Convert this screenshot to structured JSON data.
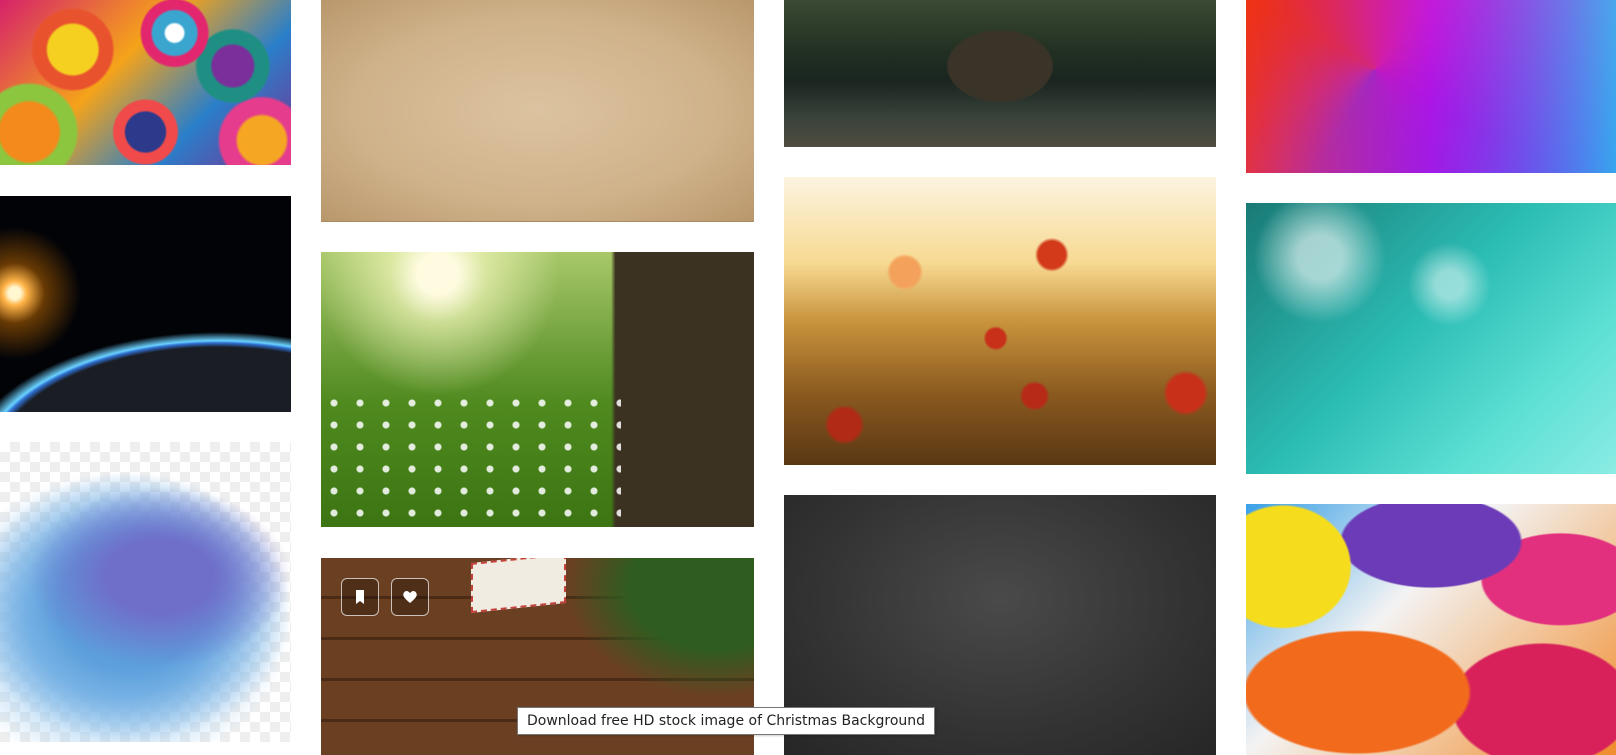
{
  "gallery": {
    "tiles": [
      {
        "icon": "colorful-mandala-image"
      },
      {
        "icon": "earth-from-space-image"
      },
      {
        "icon": "blue-watercolor-image"
      },
      {
        "icon": "old-paper-texture-image"
      },
      {
        "icon": "sunny-meadow-flowers-image"
      },
      {
        "icon": "christmas-wood-background-image"
      },
      {
        "icon": "mountain-lake-image"
      },
      {
        "icon": "poppy-field-sunset-image"
      },
      {
        "icon": "chalkboard-texture-image"
      },
      {
        "icon": "low-poly-gradient-image"
      },
      {
        "icon": "dandelion-dew-drops-image"
      },
      {
        "icon": "abstract-paint-image"
      }
    ],
    "hover_actions": {
      "bookmark_icon": "bookmark-icon",
      "like_icon": "heart-icon"
    }
  },
  "tooltip": {
    "text": "Download free HD stock image of Christmas Background"
  }
}
